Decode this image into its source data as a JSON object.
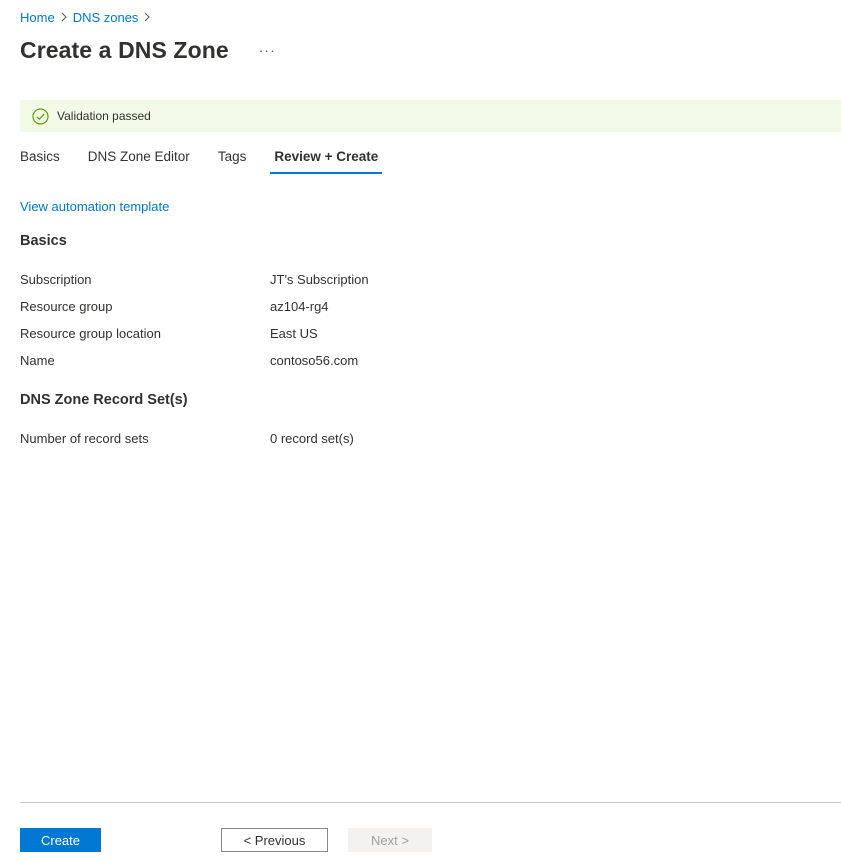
{
  "breadcrumb": {
    "items": [
      {
        "label": "Home"
      },
      {
        "label": "DNS zones"
      }
    ]
  },
  "header": {
    "title": "Create a DNS Zone",
    "more_label": "···"
  },
  "validation": {
    "message": "Validation passed",
    "status_color": "#57a300",
    "banner_color": "#f3fbe8"
  },
  "tabs": [
    {
      "label": "Basics",
      "active": false
    },
    {
      "label": "DNS Zone Editor",
      "active": false
    },
    {
      "label": "Tags",
      "active": false
    },
    {
      "label": "Review + Create",
      "active": true
    }
  ],
  "automation_link": "View automation template",
  "sections": [
    {
      "heading": "Basics",
      "rows": [
        {
          "label": "Subscription",
          "value": "JT's Subscription"
        },
        {
          "label": "Resource group",
          "value": "az104-rg4"
        },
        {
          "label": "Resource group location",
          "value": "East US"
        },
        {
          "label": "Name",
          "value": "contoso56.com"
        }
      ]
    },
    {
      "heading": "DNS Zone Record Set(s)",
      "rows": [
        {
          "label": "Number of record sets",
          "value": "0 record set(s)"
        }
      ]
    }
  ],
  "footer": {
    "create_label": "Create",
    "previous_label": "< Previous",
    "next_label": "Next >",
    "next_disabled": true
  },
  "colors": {
    "accent": "#0078d4",
    "text": "#323130"
  },
  "icons": {
    "breadcrumb_separator": "chevron-right-icon",
    "validation": "check-circle-icon",
    "more": "more-horizontal-icon"
  }
}
